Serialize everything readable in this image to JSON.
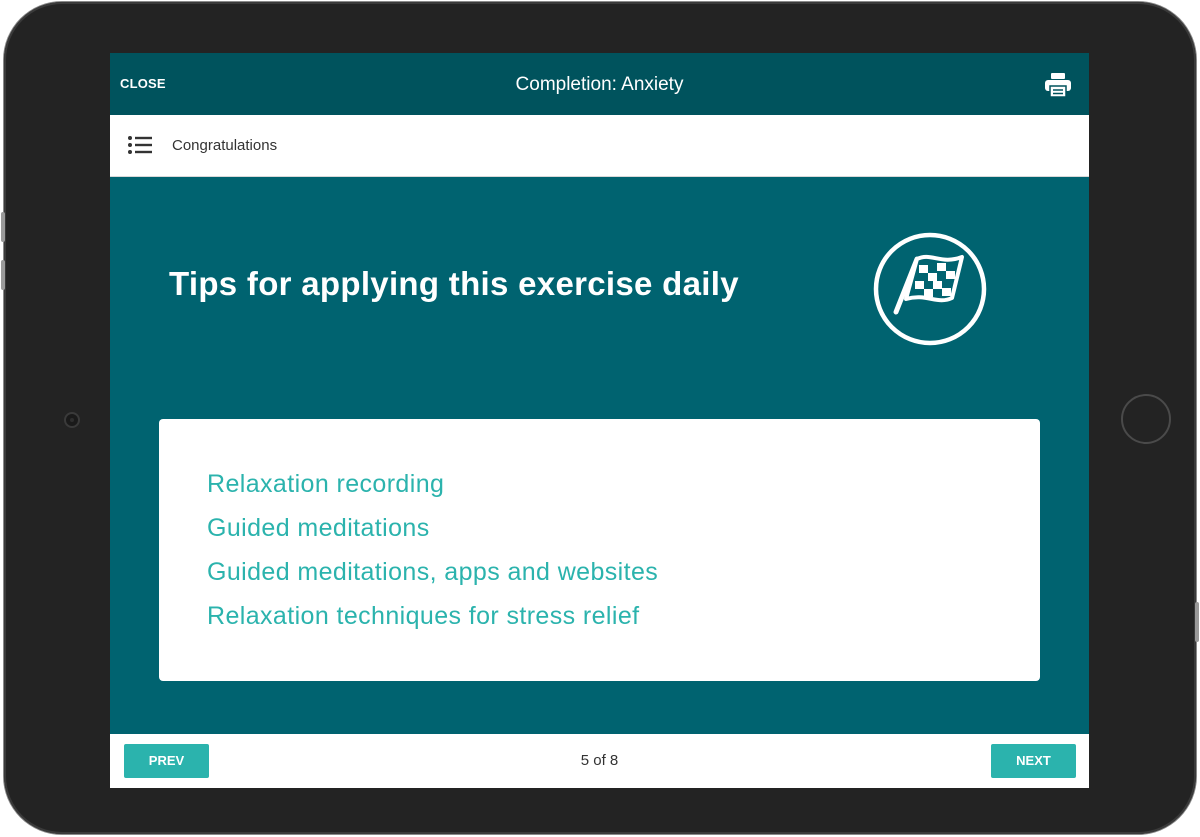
{
  "header": {
    "close_label": "CLOSE",
    "title": "Completion: Anxiety",
    "print_icon": "printer-icon"
  },
  "subheader": {
    "menu_icon": "list-menu-icon",
    "section_label": "Congratulations"
  },
  "content": {
    "heading": "Tips for applying this exercise daily",
    "badge_icon": "checkered-flag-icon",
    "links": [
      "Relaxation recording",
      "Guided meditations",
      "Guided meditations, apps and websites",
      "Relaxation techniques for stress relief"
    ]
  },
  "footer": {
    "prev_label": "PREV",
    "page_indicator": "5 of 8",
    "next_label": "NEXT"
  },
  "colors": {
    "header_bg": "#00535d",
    "content_bg": "#006370",
    "accent": "#2bb3ad",
    "device_bezel": "#232323"
  }
}
